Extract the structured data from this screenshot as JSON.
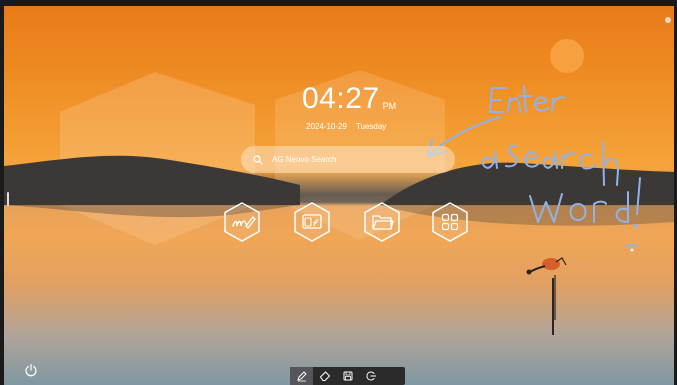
{
  "clock": {
    "time": "04:27",
    "ampm": "PM"
  },
  "date": {
    "date": "2024-10-29",
    "weekday": "Tuesday"
  },
  "search": {
    "placeholder": "AG Neovo Search"
  },
  "apps": [
    {
      "name": "whiteboard-app",
      "icon": "pen-on-paper-icon"
    },
    {
      "name": "screen-share-app",
      "icon": "cast-icon"
    },
    {
      "name": "file-manager-app",
      "icon": "folder-icon"
    },
    {
      "name": "all-apps",
      "icon": "apps-grid-icon"
    }
  ],
  "annotation": {
    "text_lines": [
      "Enter",
      "a search",
      "word !"
    ],
    "color": "#8fb3e8"
  },
  "toolbar": {
    "tools": [
      "pen-icon",
      "eraser-icon",
      "save-icon",
      "exit-icon"
    ],
    "active": "pen-icon"
  },
  "colors": {
    "sky_top": "#e77a19",
    "sun": "#f6a040",
    "hills": "#3e3a38",
    "toolbar_bg": "#2b2b2b"
  }
}
